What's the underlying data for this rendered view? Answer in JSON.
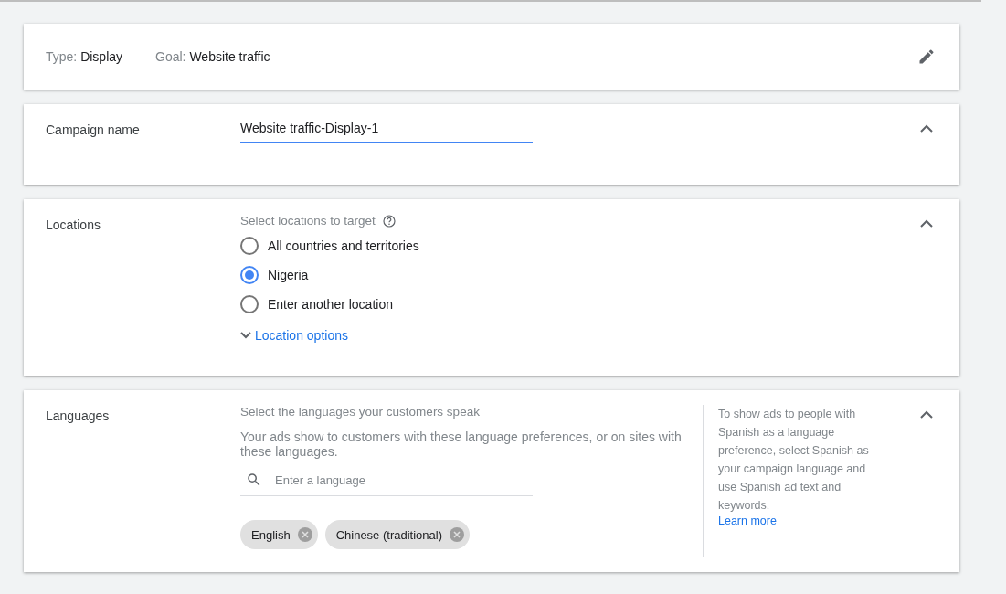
{
  "summary": {
    "items": [
      {
        "label": "Type:",
        "value": "Display"
      },
      {
        "label": "Goal:",
        "value": "Website traffic"
      }
    ]
  },
  "campaign_name": {
    "label": "Campaign name",
    "value": "Website traffic-Display-1",
    "expanded": true
  },
  "locations": {
    "label": "Locations",
    "expanded": true,
    "prompt": "Select locations to target",
    "options": [
      {
        "label": "All countries and territories",
        "selected": false
      },
      {
        "label": "Nigeria",
        "selected": true
      },
      {
        "label": "Enter another location",
        "selected": false
      }
    ],
    "more_link": "Location options"
  },
  "languages": {
    "label": "Languages",
    "expanded": true,
    "prompt": "Select the languages your customers speak",
    "description": "Your ads show to customers with these language preferences, or on sites with these languages.",
    "search": {
      "placeholder": "Enter a language"
    },
    "chips": [
      "English",
      "Chinese (traditional)"
    ],
    "tip": "To show ads to people with Spanish as a language preference, select Spanish as your campaign language and use Spanish ad text and keywords.",
    "tip_link": "Learn more"
  }
}
